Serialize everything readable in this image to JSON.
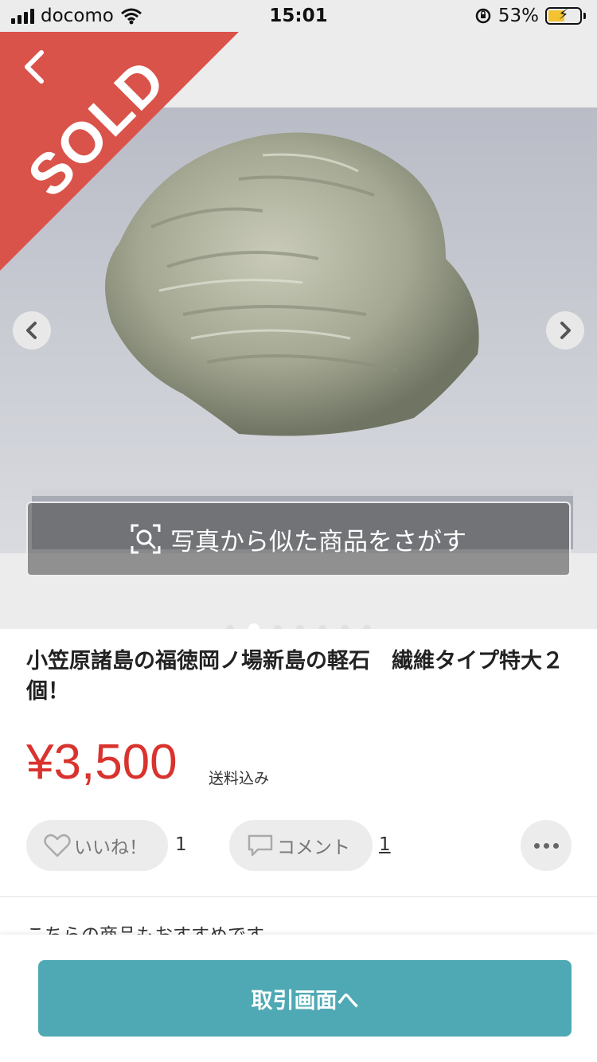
{
  "status_bar": {
    "carrier": "docomo",
    "time": "15:01",
    "battery": "53%",
    "battery_level": 0.53
  },
  "gallery": {
    "sold_label": "SOLD",
    "search_similar_label": "写真から似た商品をさがす",
    "page_count": 7,
    "active_index": 1
  },
  "item": {
    "title": "小笠原諸島の福徳岡ノ場新島の軽石　繊維タイプ特大２個！",
    "price": "¥3,500",
    "shipping": "送料込み"
  },
  "actions": {
    "like_label": "いいね！",
    "like_count": "1",
    "comment_label": "コメント",
    "comment_count": "1"
  },
  "recommend_text": "こちらの商品もおすすめです",
  "cta_label": "取引画面へ",
  "colors": {
    "sold_red": "#d9534a",
    "price_red": "#d9332f",
    "cta_teal": "#4fa9b4"
  },
  "icons": [
    "back-chevron",
    "chevron-left",
    "chevron-right",
    "image-search",
    "heart",
    "comment-bubble",
    "more-dots"
  ]
}
